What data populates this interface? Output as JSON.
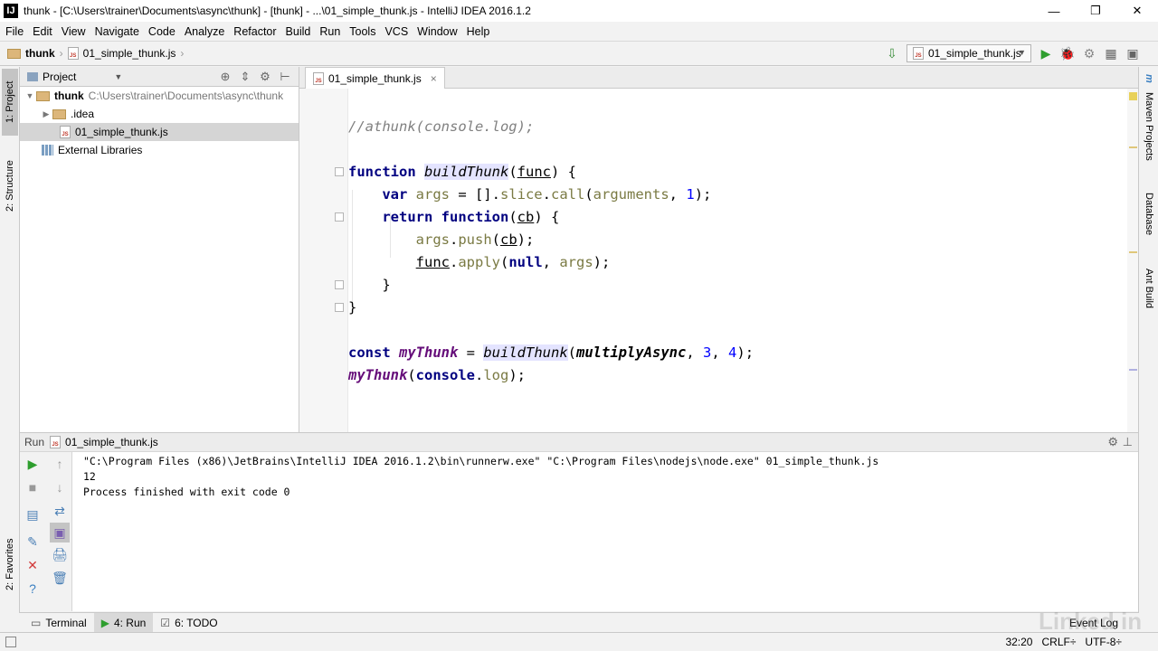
{
  "window": {
    "app_icon": "IJ",
    "title": "thunk - [C:\\Users\\trainer\\Documents\\async\\thunk] - [thunk] - ...\\01_simple_thunk.js - IntelliJ IDEA 2016.1.2",
    "controls": {
      "minimize": "—",
      "restore": "❐",
      "close": "✕"
    }
  },
  "menu": [
    "File",
    "Edit",
    "View",
    "Navigate",
    "Code",
    "Analyze",
    "Refactor",
    "Build",
    "Run",
    "Tools",
    "VCS",
    "Window",
    "Help"
  ],
  "breadcrumb": {
    "project": "thunk",
    "file": "01_simple_thunk.js",
    "separator": "›"
  },
  "run_config": {
    "label": "01_simple_thunk.js",
    "dropdown": "▼"
  },
  "nav_tools": [
    "▶",
    "🐞",
    "⚙",
    "▦",
    "▣"
  ],
  "left_tool_tabs": [
    {
      "label": "1: Project"
    },
    {
      "label": "2: Structure"
    },
    {
      "label": "2: Favorites"
    }
  ],
  "right_tool_tabs": [
    {
      "icon": "m",
      "label": "Maven Projects"
    },
    {
      "label": "Database"
    },
    {
      "label": "Ant Build"
    }
  ],
  "project_panel": {
    "title": "Project",
    "dropdown": "▼",
    "tools": [
      "⊕",
      "⇕",
      "⚙",
      "⊢"
    ],
    "tree": [
      {
        "arrow": "▼",
        "name": "thunk",
        "path": "C:\\Users\\trainer\\Documents\\async\\thunk"
      },
      {
        "arrow": "▶",
        "name": ".idea"
      },
      {
        "name": "01_simple_thunk.js",
        "selected": true
      },
      {
        "name": "External Libraries"
      }
    ]
  },
  "editor": {
    "tab_label": "01_simple_thunk.js",
    "tab_close": "×",
    "js_icon": "JS",
    "current_line_index": 10,
    "lines": [
      [
        {
          "t": "//athunk(console.log);",
          "c": "cmt"
        }
      ],
      [],
      [
        {
          "t": "function ",
          "c": "kw"
        },
        {
          "t": "buildThunk",
          "c": "fnu"
        },
        {
          "t": "("
        },
        {
          "t": "func",
          "c": "par"
        },
        {
          "t": ") {"
        }
      ],
      [
        {
          "t": "    "
        },
        {
          "t": "var ",
          "c": "kw"
        },
        {
          "t": "args",
          "c": "prop"
        },
        {
          "t": " = []."
        },
        {
          "t": "slice",
          "c": "prop"
        },
        {
          "t": "."
        },
        {
          "t": "call",
          "c": "prop"
        },
        {
          "t": "("
        },
        {
          "t": "arguments",
          "c": "prop"
        },
        {
          "t": ", "
        },
        {
          "t": "1",
          "c": "num"
        },
        {
          "t": ");"
        }
      ],
      [
        {
          "t": "    "
        },
        {
          "t": "return ",
          "c": "kw"
        },
        {
          "t": "function",
          "c": "kw"
        },
        {
          "t": "("
        },
        {
          "t": "cb",
          "c": "par"
        },
        {
          "t": ") {"
        }
      ],
      [
        {
          "t": "        "
        },
        {
          "t": "args",
          "c": "prop"
        },
        {
          "t": "."
        },
        {
          "t": "push",
          "c": "prop"
        },
        {
          "t": "("
        },
        {
          "t": "cb",
          "c": "par"
        },
        {
          "t": ");"
        }
      ],
      [
        {
          "t": "        "
        },
        {
          "t": "func",
          "c": "par"
        },
        {
          "t": "."
        },
        {
          "t": "apply",
          "c": "prop"
        },
        {
          "t": "("
        },
        {
          "t": "null",
          "c": "kw"
        },
        {
          "t": ", "
        },
        {
          "t": "args",
          "c": "prop"
        },
        {
          "t": ");"
        }
      ],
      [
        {
          "t": "    }"
        }
      ],
      [
        {
          "t": "}"
        }
      ],
      [],
      [
        {
          "t": "const ",
          "c": "kw"
        },
        {
          "t": "myThunk",
          "c": "gvar"
        },
        {
          "t": " = "
        },
        {
          "t": "buildThunk",
          "c": "fnu"
        },
        {
          "t": "("
        },
        {
          "t": "multiplyAsync",
          "c": "fn"
        },
        {
          "t": ", "
        },
        {
          "t": "3",
          "c": "num"
        },
        {
          "t": ", "
        },
        {
          "t": "4",
          "c": "num"
        },
        {
          "t": ");"
        }
      ],
      [
        {
          "t": "myThunk",
          "c": "gvar"
        },
        {
          "t": "("
        },
        {
          "t": "console",
          "c": "kw"
        },
        {
          "t": "."
        },
        {
          "t": "log",
          "c": "prop"
        },
        {
          "t": ");"
        }
      ]
    ]
  },
  "run_panel": {
    "title": "Run",
    "config": "01_simple_thunk.js",
    "gear": "⚙",
    "minimize": "⊥",
    "tools_left": [
      "▶",
      "■",
      "▤",
      "✎",
      "✕",
      "?"
    ],
    "tools_right": [
      "↑",
      "↓",
      "⇄",
      "▣",
      "🖨",
      "🗑"
    ],
    "output": [
      "\"C:\\Program Files (x86)\\JetBrains\\IntelliJ IDEA 2016.1.2\\bin\\runnerw.exe\" \"C:\\Program Files\\nodejs\\node.exe\" 01_simple_thunk.js",
      "12",
      "",
      "Process finished with exit code 0"
    ]
  },
  "bottom_tabs": [
    {
      "icon": "▭",
      "label": "Terminal"
    },
    {
      "icon": "▶",
      "label": "4: Run",
      "active": true
    },
    {
      "icon": "☑",
      "label": "6: TODO"
    }
  ],
  "status": {
    "event_log": "Event Log",
    "position": "32:20",
    "line_sep": "CRLF÷",
    "encoding": "UTF-8÷",
    "watermark": "Linked in"
  }
}
